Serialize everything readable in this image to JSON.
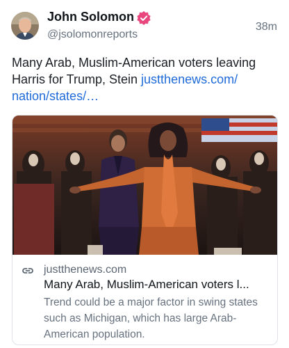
{
  "post": {
    "author_name": "John Solomon",
    "handle": "@jsolomonreports",
    "time": "38m",
    "text": "Many Arab, Muslim-American voters leaving Harris for Trump, Stein ",
    "link_text": "justthenews.com/\nnation/states/…"
  },
  "card": {
    "domain": "justthenews.com",
    "title": "Many Arab, Muslim-American voters l...",
    "description": "Trend could be a major factor in swing states such as Michigan, which has large Arab-American population."
  },
  "icons": {
    "verified": "verified-badge-icon",
    "link": "link-icon"
  },
  "colors": {
    "link": "#1e6ad8",
    "verified": "#e8467c",
    "muted": "#66717e"
  }
}
